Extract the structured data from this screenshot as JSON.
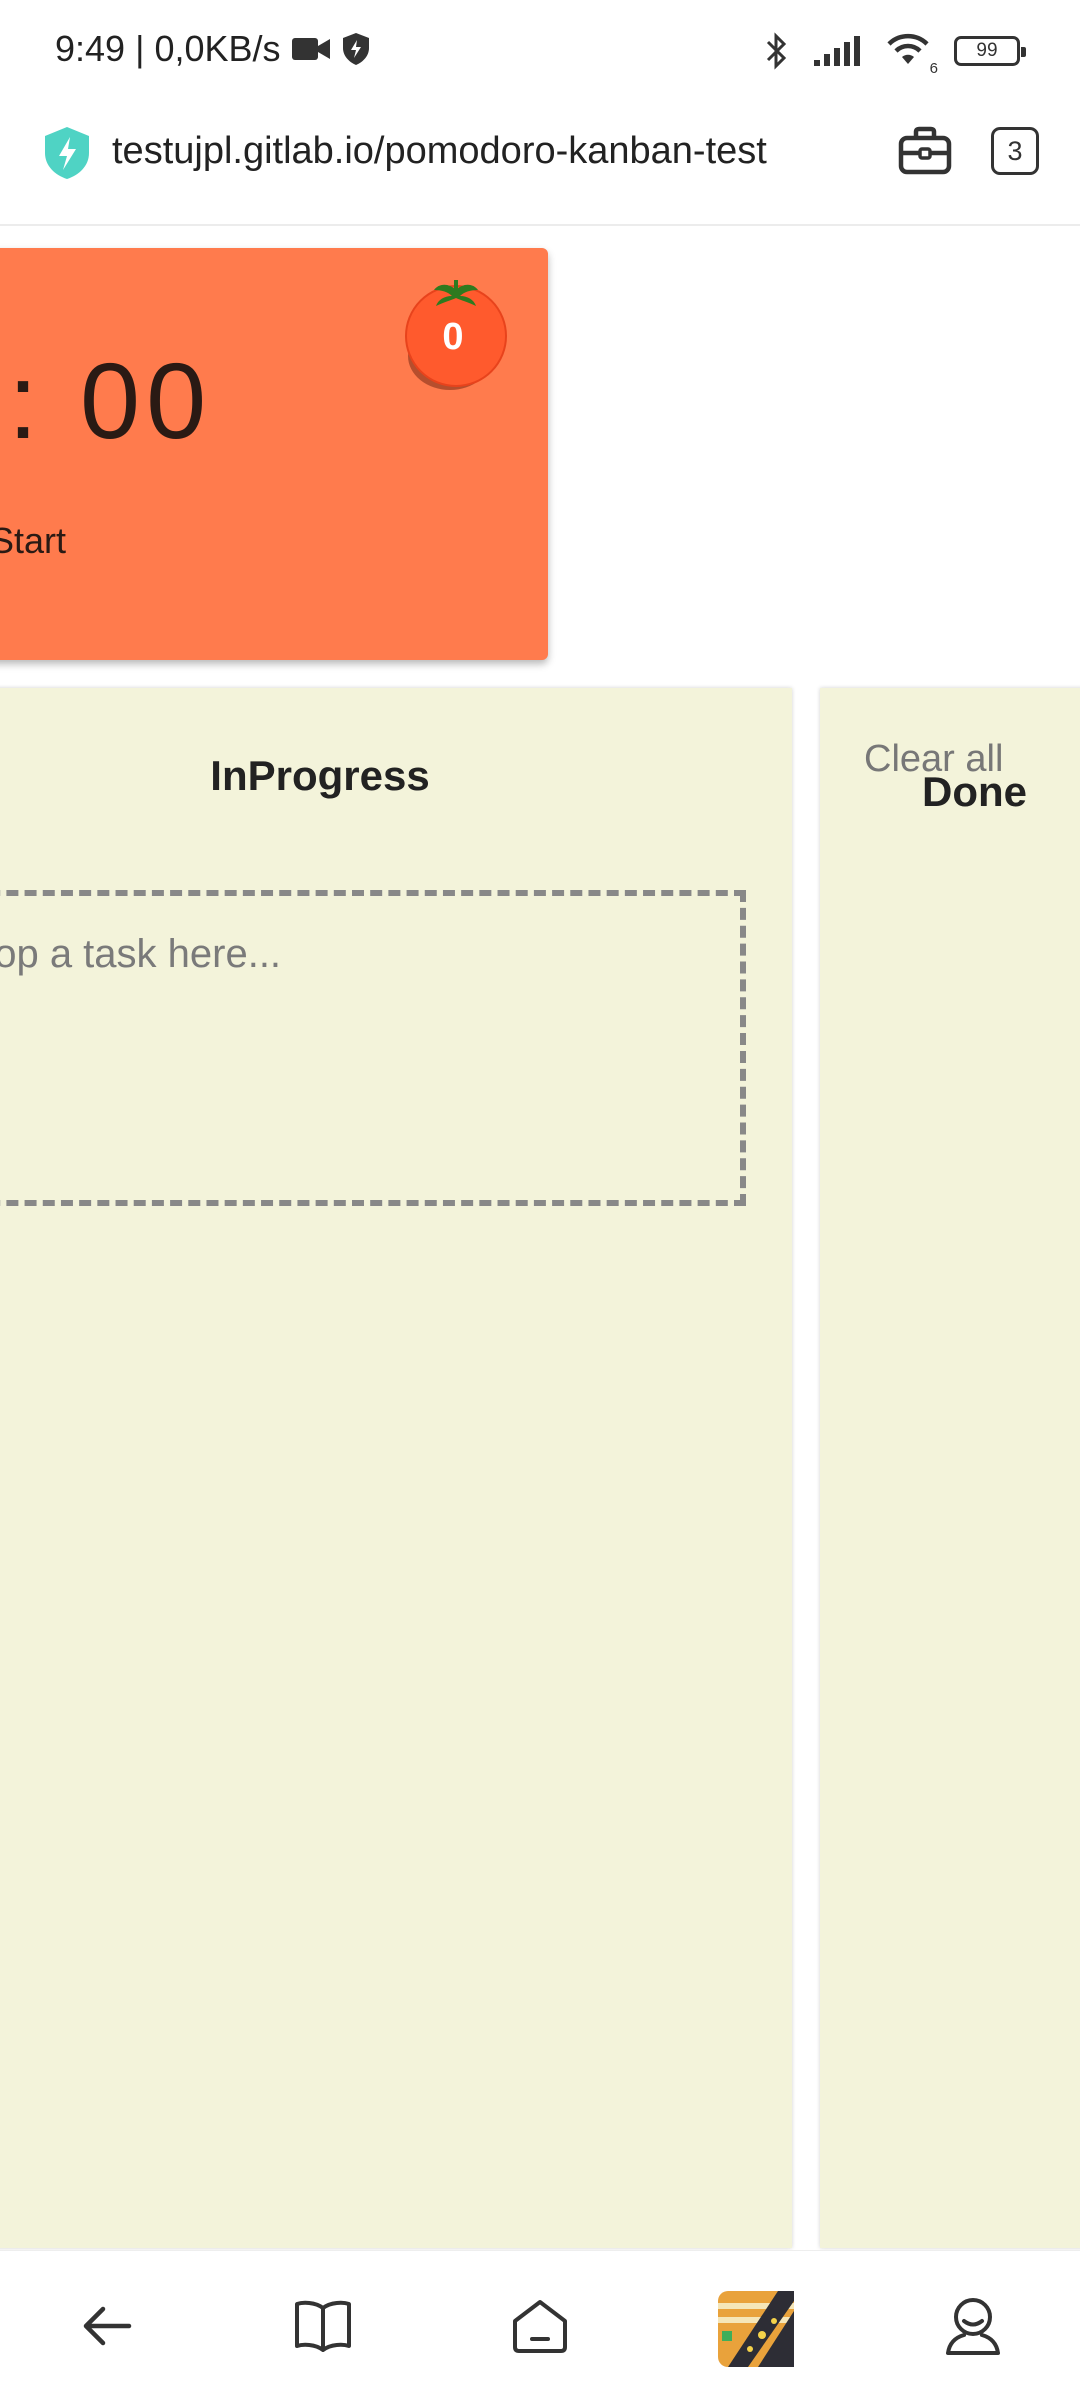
{
  "status_bar": {
    "time": "9:49",
    "separator": "|",
    "network_speed": "0,0KB/s",
    "battery": "99",
    "wifi_badge": "6",
    "icons": [
      "video-camera-icon",
      "shield-icon",
      "bluetooth-icon",
      "signal-icon",
      "wifi-icon",
      "battery-icon"
    ]
  },
  "browser": {
    "url": "testujpl.gitlab.io/pomodoro-kanban-test",
    "tab_count": "3",
    "icons": [
      "secure-bolt-icon",
      "briefcase-icon",
      "tabs-icon"
    ],
    "nav_icons": [
      "back-arrow-icon",
      "bookmarks-icon",
      "home-icon",
      "game-thumbnail-icon",
      "profile-icon"
    ]
  },
  "pomodoro": {
    "timer": ": 00",
    "start_label": "Start",
    "tomato_count": "0",
    "card_color": "#ff7b4d"
  },
  "board": {
    "columns": [
      {
        "title": "InProgress",
        "placeholder": "Drop a task here..."
      },
      {
        "title": "Done",
        "action": "Clear all"
      }
    ],
    "column_color": "#f3f3da"
  }
}
